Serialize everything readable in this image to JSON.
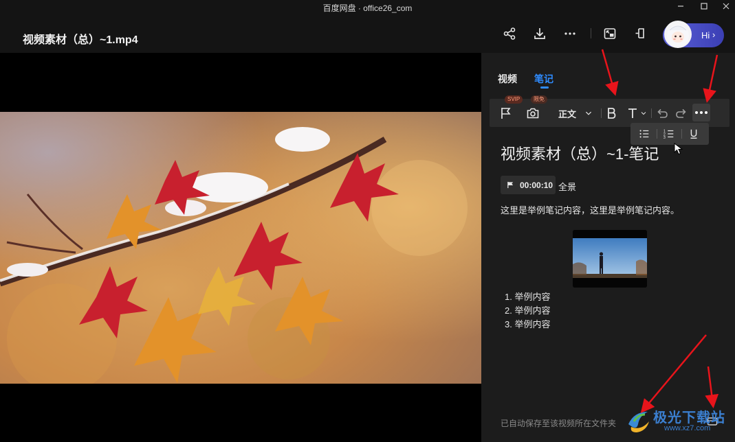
{
  "window": {
    "title": "百度网盘 · office26_com",
    "controls": [
      "minimize-icon",
      "maximize-icon",
      "close-icon"
    ]
  },
  "header": {
    "video_title": "视频素材（总）~1.mp4",
    "actions": [
      "share-icon",
      "download-icon",
      "more-icon",
      "picture-in-picture-icon",
      "pin-icon"
    ],
    "assistant": {
      "label": "Hi",
      "chevron": "›"
    }
  },
  "panel": {
    "tabs": [
      {
        "label": "视频",
        "active": false
      },
      {
        "label": "笔记",
        "active": true
      }
    ],
    "toolbar": {
      "flag_badge": "SVIP",
      "camera_badge": "限免",
      "paragraph_style": "正文",
      "items": [
        "flag-icon",
        "camera-icon",
        "bold-icon",
        "text-size-icon",
        "undo-icon",
        "redo-icon",
        "more-icon"
      ]
    },
    "format_menu": [
      "bulleted-list-icon",
      "numbered-list-icon",
      "underline-icon"
    ],
    "note": {
      "title": "视频素材（总）~1-笔记",
      "timestamp": "00:00:10",
      "timestamp_label": "全景",
      "paragraph": "这里是举例笔记内容，这里是举例笔记内容。",
      "list": [
        "1. 举例内容",
        "2. 举例内容",
        "3. 举例内容"
      ]
    },
    "autosave_text": "已自动保存至该视频所在文件夹"
  },
  "watermark": {
    "text": "极光下载站",
    "url": "www.xz7.com"
  },
  "colors": {
    "accent": "#2f8cff",
    "annotation": "#e8141b",
    "panel_bg": "#1c1c1c",
    "app_bg": "#141414"
  }
}
